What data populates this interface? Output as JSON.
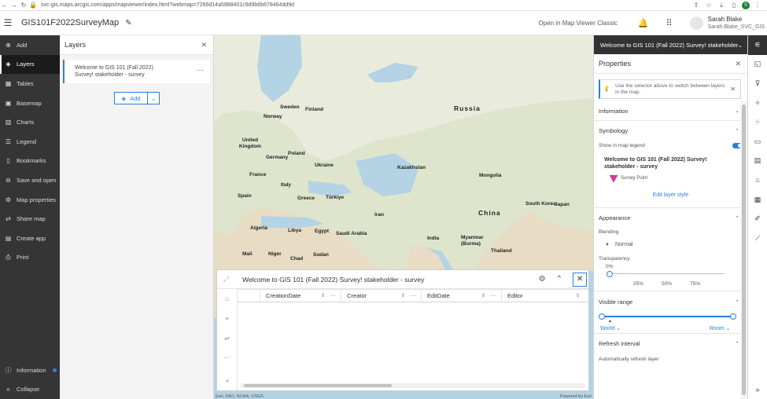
{
  "browser": {
    "url": "svc-gis.maps.arcgis.com/apps/mapviewer/index.html?webmap=7266d14a5988401c9d9b6b678464dd9d",
    "account_initial": "S"
  },
  "header": {
    "title": "GIS101F2022SurveyMap",
    "classic_link": "Open in Map Viewer Classic",
    "user_name": "Sarah Blake",
    "user_id": "Sarah.Blake_SVC_GIS"
  },
  "nav": {
    "items": [
      {
        "label": "Add",
        "icon": "plus-circle-icon"
      },
      {
        "label": "Layers",
        "icon": "layers-icon"
      },
      {
        "label": "Tables",
        "icon": "table-icon"
      },
      {
        "label": "Basemap",
        "icon": "basemap-icon"
      },
      {
        "label": "Charts",
        "icon": "chart-icon"
      },
      {
        "label": "Legend",
        "icon": "legend-icon"
      },
      {
        "label": "Bookmarks",
        "icon": "bookmark-icon"
      },
      {
        "label": "Save and open",
        "icon": "save-icon"
      },
      {
        "label": "Map properties",
        "icon": "gear-icon"
      },
      {
        "label": "Share map",
        "icon": "share-icon"
      },
      {
        "label": "Create app",
        "icon": "app-icon"
      },
      {
        "label": "Print",
        "icon": "print-icon"
      }
    ],
    "active": "Layers",
    "information": "Information",
    "collapse": "Collapse"
  },
  "layers": {
    "title": "Layers",
    "layer_line1": "Welcome to GIS 101 (Fall 2022)",
    "layer_line2": "Survey! stakeholder - survey",
    "add_label": "Add"
  },
  "map": {
    "labels": [
      "Sweden",
      "Finland",
      "Norway",
      "United Kingdom",
      "Poland",
      "Germany",
      "Ukraine",
      "France",
      "Italy",
      "Spain",
      "Greece",
      "Türkiye",
      "Kazakhstan",
      "Mongolia",
      "Russia",
      "China",
      "Iran",
      "South Korea",
      "Japan",
      "Algeria",
      "Libya",
      "Egypt",
      "Saudi Arabia",
      "India",
      "Myanmar (Burma)",
      "Thailand",
      "Mali",
      "Niger",
      "Chad",
      "Sudan"
    ],
    "attribution": "Esri, FAO, NOAA, USGS",
    "powered": "Powered by Esri"
  },
  "table": {
    "title": "Welcome to GIS 101 (Fall 2022) Survey! stakeholder - survey",
    "columns": [
      "CreationDate",
      "Creator",
      "EditDate",
      "Editor"
    ]
  },
  "properties": {
    "layer_selector": "Welcome to GIS 101 (Fall 2022) Survey! stakeholder - survey",
    "title": "Properties",
    "note": "Use the selector above to switch between layers in the map.",
    "information": "Information",
    "symbology": "Symbology",
    "show_legend": "Show in map legend",
    "symbol_title": "Welcome to GIS 101 (Fall 2022) Survey! stakeholder - survey",
    "symbol_label": "Survey Point",
    "edit_style": "Edit layer style",
    "appearance": "Appearance",
    "blending": "Blending",
    "blend_value": "Normal",
    "transparency": "Transparency",
    "transparency_value": "0%",
    "ticks": [
      "25%",
      "50%",
      "75%"
    ],
    "visible_range": "Visible range",
    "range_min": "World",
    "range_max": "Room",
    "refresh_interval": "Refresh interval",
    "auto_refresh": "Automatically refresh layer"
  },
  "colors": {
    "accent": "#2b7de0",
    "nav_bg": "#353535",
    "symbol": "#e0379a"
  }
}
